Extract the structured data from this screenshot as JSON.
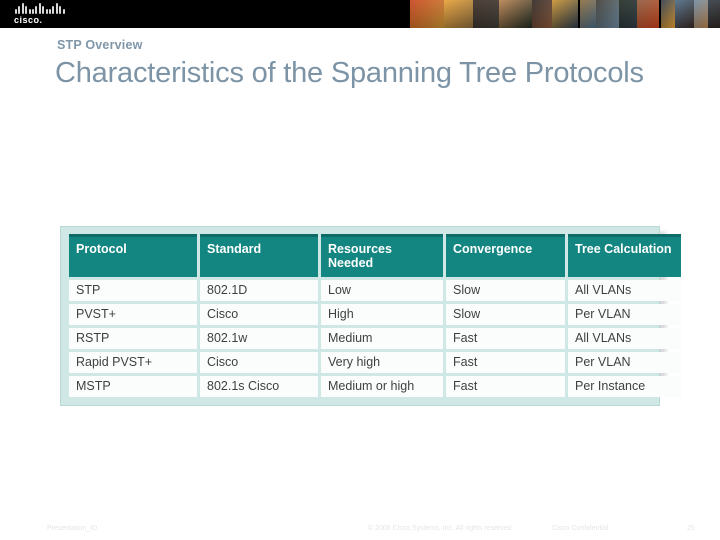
{
  "topbar": {
    "logo_name": "cisco-logo",
    "logo_text": "cisco.",
    "montage_name": "people-photo-montage",
    "montage_colors": [
      "#c8421a",
      "#e8a033",
      "#3a2a22",
      "#b9824f",
      "#2d2420",
      "#c9912f",
      "#8a6a3a",
      "#3c3a33",
      "#1f2a20",
      "#8d5a3c",
      "#2b3a4a",
      "#4a6a86",
      "#6d8aa0",
      "#2f3a44"
    ]
  },
  "heading": {
    "eyebrow": "STP Overview",
    "title": "Characteristics of the Spanning Tree Protocols"
  },
  "table": {
    "name": "spanning-tree-protocol-comparison-table",
    "headers": [
      "Protocol",
      "Standard",
      "Resources Needed",
      "Convergence",
      "Tree Calculation"
    ],
    "rows": [
      [
        "STP",
        "802.1D",
        "Low",
        "Slow",
        "All VLANs"
      ],
      [
        "PVST+",
        "Cisco",
        "High",
        "Slow",
        "Per VLAN"
      ],
      [
        "RSTP",
        "802.1w",
        "Medium",
        "Fast",
        "All VLANs"
      ],
      [
        "Rapid PVST+",
        "Cisco",
        "Very high",
        "Fast",
        "Per VLAN"
      ],
      [
        "MSTP",
        "802.1s  Cisco",
        "Medium or high",
        "Fast",
        "Per Instance"
      ]
    ],
    "header_bg": "#138682",
    "header_top_strip": "#0e6b68",
    "frame_bg": "#cfe8e6",
    "cell_bg": "#fbfdfd"
  },
  "footer": {
    "presentation_id": "Presentation_ID",
    "copyright": "© 2008 Cisco Systems, Inc. All rights reserved.",
    "confidentiality": "Cisco Confidential",
    "page_number": "25"
  },
  "colors": {
    "title_text": "#7c94a6",
    "eyebrow_text": "#7f96a8",
    "topbar_bg": "#000000",
    "slide_bg": "#ffffff"
  }
}
